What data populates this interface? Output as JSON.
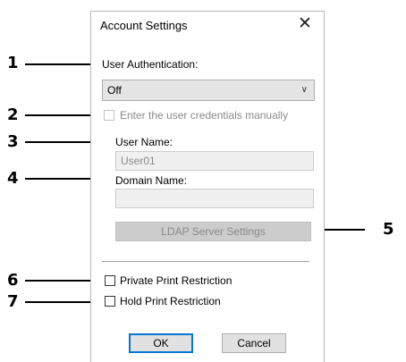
{
  "dialog": {
    "title": "Account Settings",
    "close_glyph": "✕",
    "user_auth_label": "User Authentication:",
    "user_auth_value": "Off",
    "enter_credentials_label": "Enter the user credentials manually",
    "user_name_label": "User Name:",
    "user_name_value": "User01",
    "domain_name_label": "Domain Name:",
    "domain_name_value": "",
    "ldap_button": "LDAP Server Settings",
    "private_print_label": "Private Print Restriction",
    "hold_print_label": "Hold Print Restriction",
    "ok_button": "OK",
    "cancel_button": "Cancel"
  },
  "callouts": [
    "1",
    "2",
    "3",
    "4",
    "5",
    "6",
    "7"
  ],
  "icons": {
    "dropdown": "chevron-down-icon",
    "close": "close-icon"
  }
}
